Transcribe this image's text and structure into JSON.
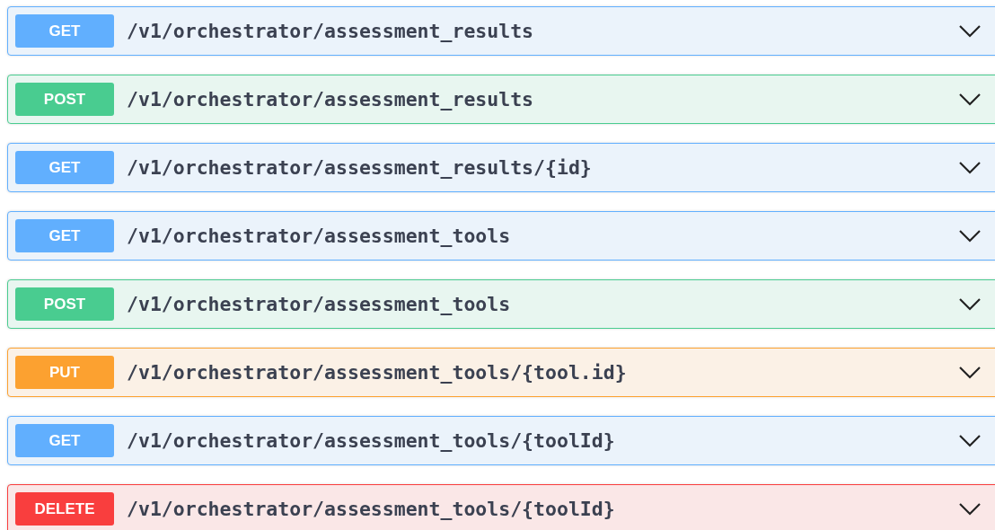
{
  "operations": [
    {
      "kind": "get",
      "method": "GET",
      "path": "/v1/orchestrator/assessment_results",
      "expanded": false
    },
    {
      "kind": "post",
      "method": "POST",
      "path": "/v1/orchestrator/assessment_results",
      "expanded": false
    },
    {
      "kind": "get",
      "method": "GET",
      "path": "/v1/orchestrator/assessment_results/{id}",
      "expanded": false
    },
    {
      "kind": "get",
      "method": "GET",
      "path": "/v1/orchestrator/assessment_tools",
      "expanded": false
    },
    {
      "kind": "post",
      "method": "POST",
      "path": "/v1/orchestrator/assessment_tools",
      "expanded": false
    },
    {
      "kind": "put",
      "method": "PUT",
      "path": "/v1/orchestrator/assessment_tools/{tool.id}",
      "expanded": false
    },
    {
      "kind": "get",
      "method": "GET",
      "path": "/v1/orchestrator/assessment_tools/{toolId}",
      "expanded": false
    },
    {
      "kind": "delete",
      "method": "DELETE",
      "path": "/v1/orchestrator/assessment_tools/{toolId}",
      "expanded": false
    }
  ]
}
